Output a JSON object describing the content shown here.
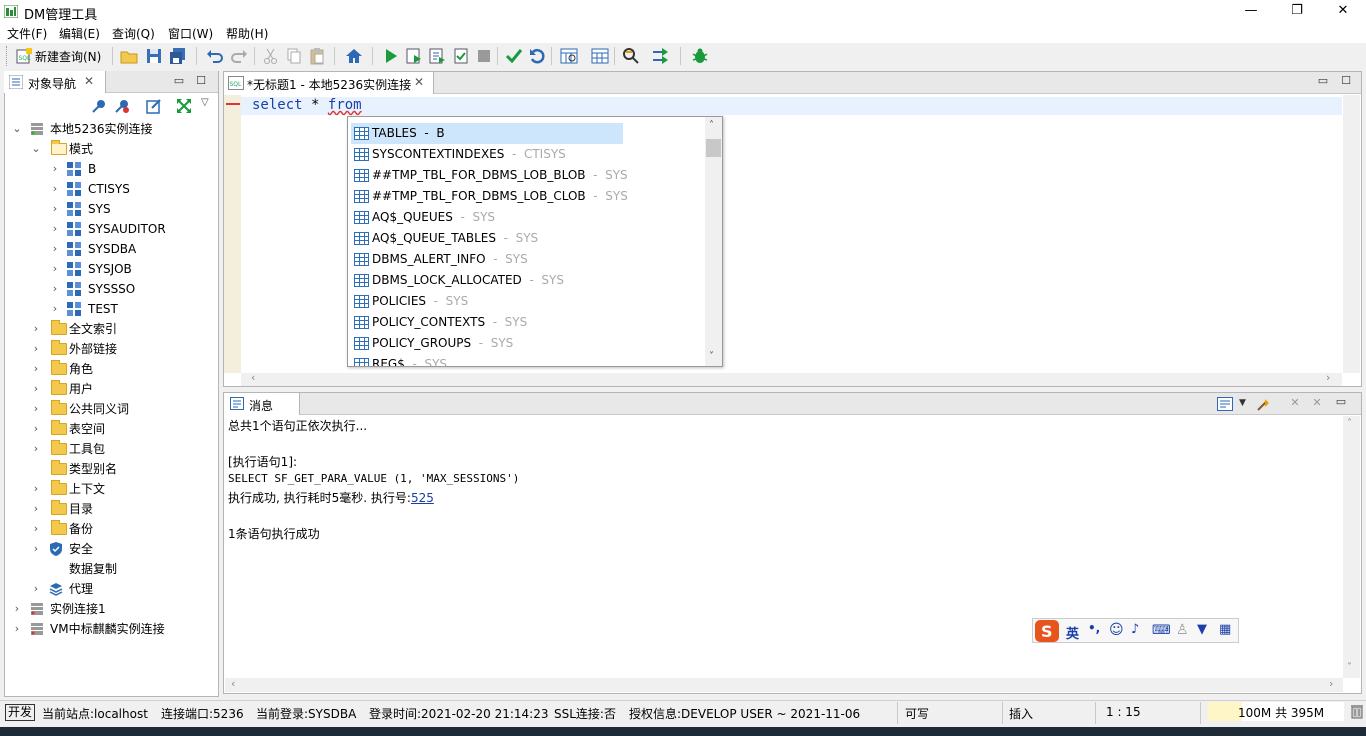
{
  "window": {
    "title": "DM管理工具",
    "min": "—",
    "restore": "❐",
    "close": "✕"
  },
  "menu": [
    "文件(F)",
    "编辑(E)",
    "查询(Q)",
    "窗口(W)",
    "帮助(H)"
  ],
  "toolbar": {
    "new_query": "新建查询(N)"
  },
  "nav": {
    "tab_label": "对象导航",
    "tree": {
      "root": "本地5236实例连接",
      "schema_folder": "模式",
      "schemas": [
        "B",
        "CTISYS",
        "SYS",
        "SYSAUDITOR",
        "SYSDBA",
        "SYSJOB",
        "SYSSSO",
        "TEST"
      ],
      "folders": [
        "全文索引",
        "外部链接",
        "角色",
        "用户",
        "公共同义词",
        "表空间",
        "工具包",
        "类型别名",
        "上下文",
        "目录",
        "备份",
        "安全",
        "数据复制",
        "代理"
      ],
      "other_connections": [
        "实例连接1",
        "VM中标麒麟实例连接"
      ]
    }
  },
  "editor": {
    "tab_label": "*无标题1 - 本地5236实例连接",
    "code": {
      "kw1": "select",
      "star": "*",
      "kw2": "from"
    }
  },
  "autocomplete": [
    {
      "name": "TABLES",
      "schema": "B"
    },
    {
      "name": "SYSCONTEXTINDEXES",
      "schema": "CTISYS"
    },
    {
      "name": "##TMP_TBL_FOR_DBMS_LOB_BLOB",
      "schema": "SYS"
    },
    {
      "name": "##TMP_TBL_FOR_DBMS_LOB_CLOB",
      "schema": "SYS"
    },
    {
      "name": "AQ$_QUEUES",
      "schema": "SYS"
    },
    {
      "name": "AQ$_QUEUE_TABLES",
      "schema": "SYS"
    },
    {
      "name": "DBMS_ALERT_INFO",
      "schema": "SYS"
    },
    {
      "name": "DBMS_LOCK_ALLOCATED",
      "schema": "SYS"
    },
    {
      "name": "POLICIES",
      "schema": "SYS"
    },
    {
      "name": "POLICY_CONTEXTS",
      "schema": "SYS"
    },
    {
      "name": "POLICY_GROUPS",
      "schema": "SYS"
    },
    {
      "name": "REG$",
      "schema": "SYS"
    }
  ],
  "messages": {
    "tab_label": "消息",
    "lines": [
      "总共1个语句正依次执行...",
      "",
      "[执行语句1]:",
      "SELECT SF_GET_PARA_VALUE (1, 'MAX_SESSIONS')",
      "执行成功, 执行耗时5毫秒. 执行号:",
      "",
      "1条语句执行成功"
    ],
    "exec_no": "525"
  },
  "ime": {
    "lang": "英",
    "punct": "•,"
  },
  "status": {
    "mode": "开发",
    "site": "当前站点:localhost",
    "port": "连接端口:5236",
    "login": "当前登录:SYSDBA",
    "login_time": "登录时间:2021-02-20 21:14:23",
    "ssl": "SSL连接:否",
    "license": "授权信息:DEVELOP USER ~ 2021-11-06",
    "writable": "可写",
    "insert": "插入",
    "pos": "1 : 15",
    "memory": "100M 共 395M",
    "memory_used_fraction": 0.25
  }
}
